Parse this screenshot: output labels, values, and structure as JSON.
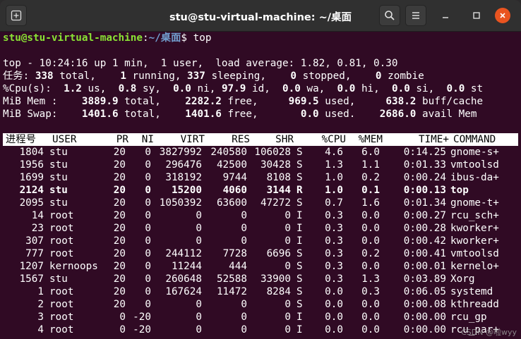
{
  "window": {
    "title": "stu@stu-virtual-machine: ~/桌面"
  },
  "colors": {
    "terminal_bg": "#300a24",
    "prompt_user": "#8ae234",
    "prompt_path": "#729fcf",
    "header_bg": "#ffffff",
    "close_btn": "#e95420"
  },
  "icons": {
    "new_tab": "new-tab-icon",
    "search": "search-icon",
    "menu": "hamburger-menu-icon",
    "minimize": "minimize-icon",
    "maximize": "maximize-icon",
    "close": "close-icon"
  },
  "prompt": {
    "user_host": "stu@stu-virtual-machine",
    "colon": ":",
    "path": "~/桌面",
    "symbol": "$",
    "command": " top"
  },
  "summary": {
    "line1": "top - 10:24:16 up 1 min,  1 user,  load average: 1.82, 0.81, 0.30",
    "tasks": {
      "label": "任务:",
      "total_v": "338",
      "total_l": " total,",
      "running_v": "1",
      "running_l": " running,",
      "sleeping_v": "337",
      "sleeping_l": " sleeping,",
      "stopped_v": "0",
      "stopped_l": " stopped,",
      "zombie_v": "0",
      "zombie_l": " zombie"
    },
    "cpu": {
      "label": "%Cpu(s):",
      "us_v": "1.2",
      "us_l": " us,",
      "sy_v": "0.8",
      "sy_l": " sy,",
      "ni_v": "0.0",
      "ni_l": " ni,",
      "id_v": "97.9",
      "id_l": " id,",
      "wa_v": "0.0",
      "wa_l": " wa,",
      "hi_v": "0.0",
      "hi_l": " hi,",
      "si_v": "0.0",
      "si_l": " si,",
      "st_v": "0.0",
      "st_l": " st"
    },
    "mem": {
      "label": "MiB Mem :",
      "total_v": "3889.9",
      "total_l": " total,",
      "free_v": "2282.2",
      "free_l": " free,",
      "used_v": "969.5",
      "used_l": " used,",
      "cache_v": "638.2",
      "cache_l": " buff/cache"
    },
    "swap": {
      "label": "MiB Swap:",
      "total_v": "1401.6",
      "total_l": " total,",
      "free_v": "1401.6",
      "free_l": " free,",
      "used_v": "0.0",
      "used_l": " used.",
      "avail_v": "2686.0",
      "avail_l": " avail Mem"
    }
  },
  "table": {
    "columns": [
      "进程号",
      "USER",
      "PR",
      "NI",
      "VIRT",
      "RES",
      "SHR",
      "",
      "%CPU",
      "%MEM",
      "TIME+",
      "COMMAND"
    ],
    "rows": [
      [
        "1804",
        "stu",
        "20",
        "0",
        "3827992",
        "240580",
        "106028",
        "S",
        "4.6",
        "6.0",
        "0:14.25",
        "gnome-s+"
      ],
      [
        "1956",
        "stu",
        "20",
        "0",
        "296476",
        "42500",
        "30428",
        "S",
        "1.3",
        "1.1",
        "0:01.33",
        "vmtoolsd"
      ],
      [
        "1699",
        "stu",
        "20",
        "0",
        "318192",
        "9744",
        "8108",
        "S",
        "1.0",
        "0.2",
        "0:00.24",
        "ibus-da+"
      ],
      [
        "2124",
        "stu",
        "20",
        "0",
        "15200",
        "4060",
        "3144",
        "R",
        "1.0",
        "0.1",
        "0:00.13",
        "top"
      ],
      [
        "2095",
        "stu",
        "20",
        "0",
        "1050392",
        "63600",
        "47272",
        "S",
        "0.7",
        "1.6",
        "0:01.34",
        "gnome-t+"
      ],
      [
        "14",
        "root",
        "20",
        "0",
        "0",
        "0",
        "0",
        "I",
        "0.3",
        "0.0",
        "0:00.27",
        "rcu_sch+"
      ],
      [
        "23",
        "root",
        "20",
        "0",
        "0",
        "0",
        "0",
        "I",
        "0.3",
        "0.0",
        "0:00.28",
        "kworker+"
      ],
      [
        "307",
        "root",
        "20",
        "0",
        "0",
        "0",
        "0",
        "I",
        "0.3",
        "0.0",
        "0:00.42",
        "kworker+"
      ],
      [
        "777",
        "root",
        "20",
        "0",
        "244112",
        "7728",
        "6696",
        "S",
        "0.3",
        "0.2",
        "0:00.41",
        "vmtoolsd"
      ],
      [
        "1207",
        "kernoops",
        "20",
        "0",
        "11244",
        "444",
        "0",
        "S",
        "0.3",
        "0.0",
        "0:00.01",
        "kernelo+"
      ],
      [
        "1567",
        "stu",
        "20",
        "0",
        "260648",
        "52588",
        "33900",
        "S",
        "0.3",
        "1.3",
        "0:03.89",
        "Xorg"
      ],
      [
        "1",
        "root",
        "20",
        "0",
        "167624",
        "11472",
        "8284",
        "S",
        "0.0",
        "0.3",
        "0:06.05",
        "systemd"
      ],
      [
        "2",
        "root",
        "20",
        "0",
        "0",
        "0",
        "0",
        "S",
        "0.0",
        "0.0",
        "0:00.08",
        "kthreadd"
      ],
      [
        "3",
        "root",
        "0",
        "-20",
        "0",
        "0",
        "0",
        "I",
        "0.0",
        "0.0",
        "0:00.00",
        "rcu_gp"
      ],
      [
        "4",
        "root",
        "0",
        "-20",
        "0",
        "0",
        "0",
        "I",
        "0.0",
        "0.0",
        "0:00.00",
        "rcu_par+"
      ]
    ],
    "bold_row_pid": "2124"
  },
  "watermark": "CSDN @啦wyy"
}
